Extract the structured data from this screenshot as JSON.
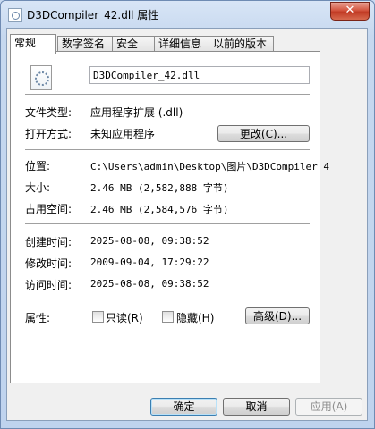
{
  "window": {
    "title": "D3DCompiler_42.dll 属性",
    "close_label": "✕"
  },
  "tabs": [
    {
      "label": "常规",
      "active": true
    },
    {
      "label": "数字签名"
    },
    {
      "label": "安全"
    },
    {
      "label": "详细信息"
    },
    {
      "label": "以前的版本"
    }
  ],
  "general": {
    "file_name": "D3DCompiler_42.dll",
    "type_label": "文件类型:",
    "type_value": "应用程序扩展 (.dll)",
    "opens_label": "打开方式:",
    "opens_value": "未知应用程序",
    "change_button": "更改(C)...",
    "location_label": "位置:",
    "location_value": "C:\\Users\\admin\\Desktop\\图片\\D3DCompiler_4",
    "size_label": "大小:",
    "size_value": "2.46 MB (2,582,888 字节)",
    "disk_label": "占用空间:",
    "disk_value": "2.46 MB (2,584,576 字节)",
    "created_label": "创建时间:",
    "created_value": "2025-08-08, 09:38:52",
    "modified_label": "修改时间:",
    "modified_value": "2009-09-04, 17:29:22",
    "accessed_label": "访问时间:",
    "accessed_value": "2025-08-08, 09:38:52",
    "attributes_label": "属性:",
    "readonly_label": "只读(R)",
    "hidden_label": "隐藏(H)",
    "advanced_button": "高级(D)..."
  },
  "footer": {
    "ok": "确定",
    "cancel": "取消",
    "apply": "应用(A)"
  }
}
